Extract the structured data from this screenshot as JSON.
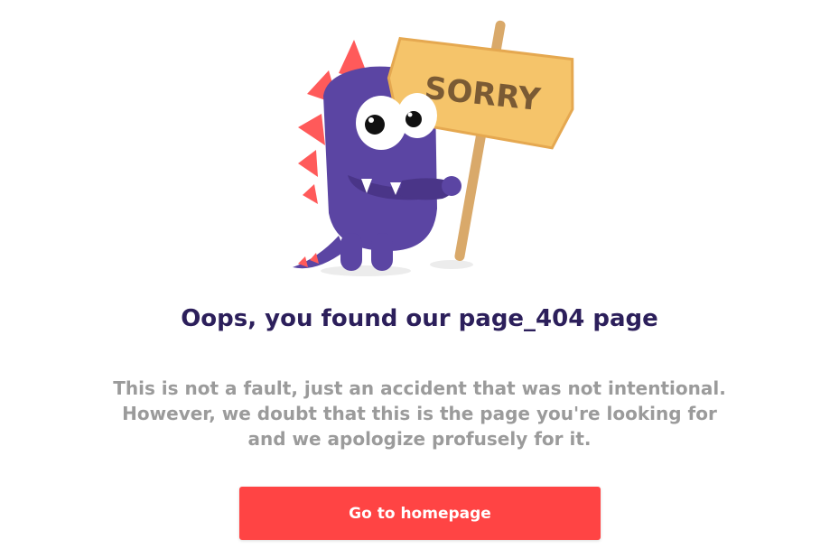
{
  "illustration": {
    "sign_text": "SORRY",
    "monster_icon": "purple-monster-holding-sign",
    "colors": {
      "monster": "#5b45a3",
      "spikes": "#ff5a5a",
      "sign": "#f5c46a",
      "pole": "#d9a96a"
    }
  },
  "title": "Oops, you found our page_404 page",
  "message": {
    "lines": [
      "This is not a fault, just an accident that was not intentional.",
      "However, we doubt that this is the page you're looking for",
      "and we apologize profusely for it."
    ]
  },
  "button": {
    "label": "Go to homepage",
    "color": "#ff4444"
  },
  "colors": {
    "title": "#2c1f5b",
    "message": "#9b9b9b"
  }
}
